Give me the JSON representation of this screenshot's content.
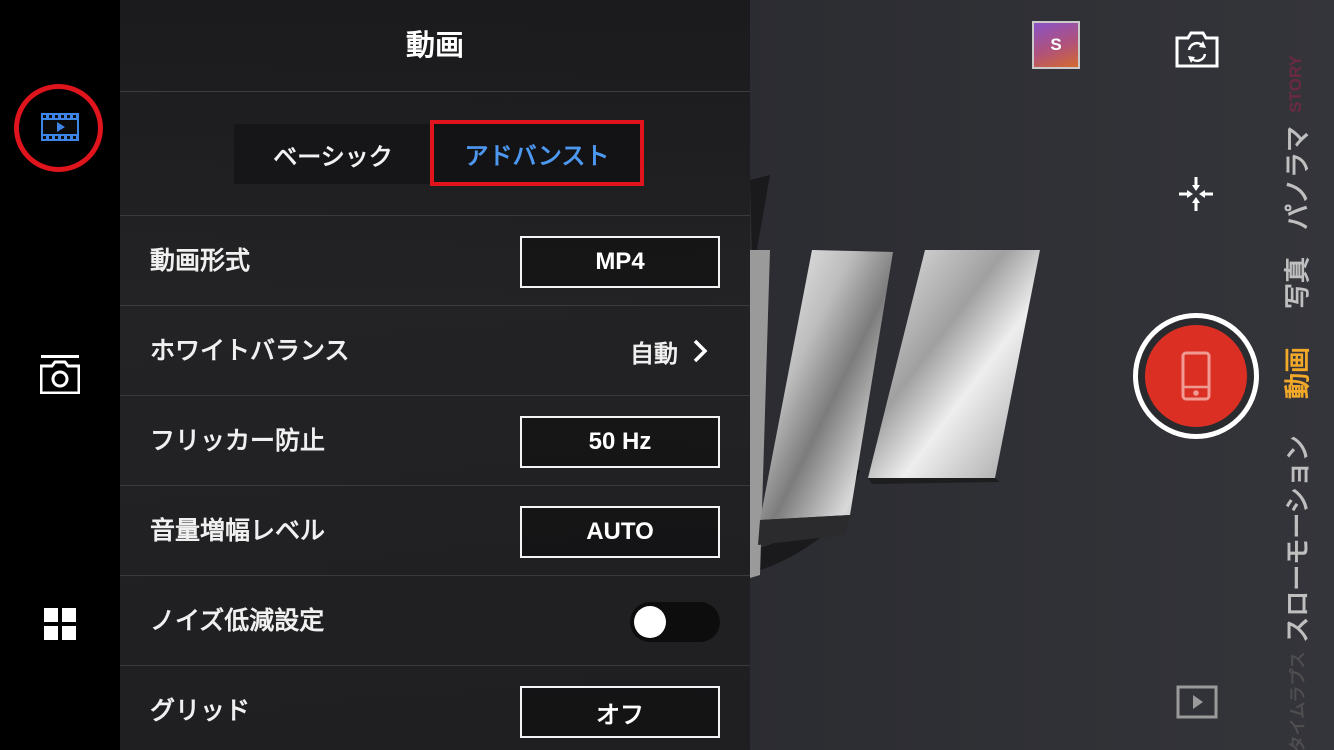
{
  "panel": {
    "title": "動画",
    "tabs": [
      {
        "label": "ベーシック",
        "selected": false
      },
      {
        "label": "アドバンスト",
        "selected": true
      }
    ],
    "rows": [
      {
        "label": "動画形式",
        "value": "MP4"
      },
      {
        "label": "ホワイトバランス",
        "value": "自動"
      },
      {
        "label": "フリッカー防止",
        "value": "50 Hz"
      },
      {
        "label": "音量増幅レベル",
        "value": "AUTO"
      },
      {
        "label": "ノイズ低減設定",
        "toggle_on": false
      },
      {
        "label": "グリッド",
        "value": "オフ"
      }
    ]
  },
  "rail": {
    "icons": [
      "film-icon",
      "camera-icon",
      "grid-icon"
    ],
    "highlight_color": "#e0141c"
  },
  "thumbnail": {
    "letter": "S"
  },
  "modes": [
    "STORY",
    "パノラマ",
    "写真",
    "動画",
    "スローモーション",
    "タイムラプス"
  ],
  "active_mode": "動画",
  "colors": {
    "accent_blue": "#4d98f0",
    "active_mode": "#f2a92a",
    "shutter": "#dc2f24",
    "highlight": "#e0141c"
  },
  "right_icons": [
    "switch-camera-icon",
    "focus-icon",
    "phone-icon",
    "play-icon"
  ]
}
